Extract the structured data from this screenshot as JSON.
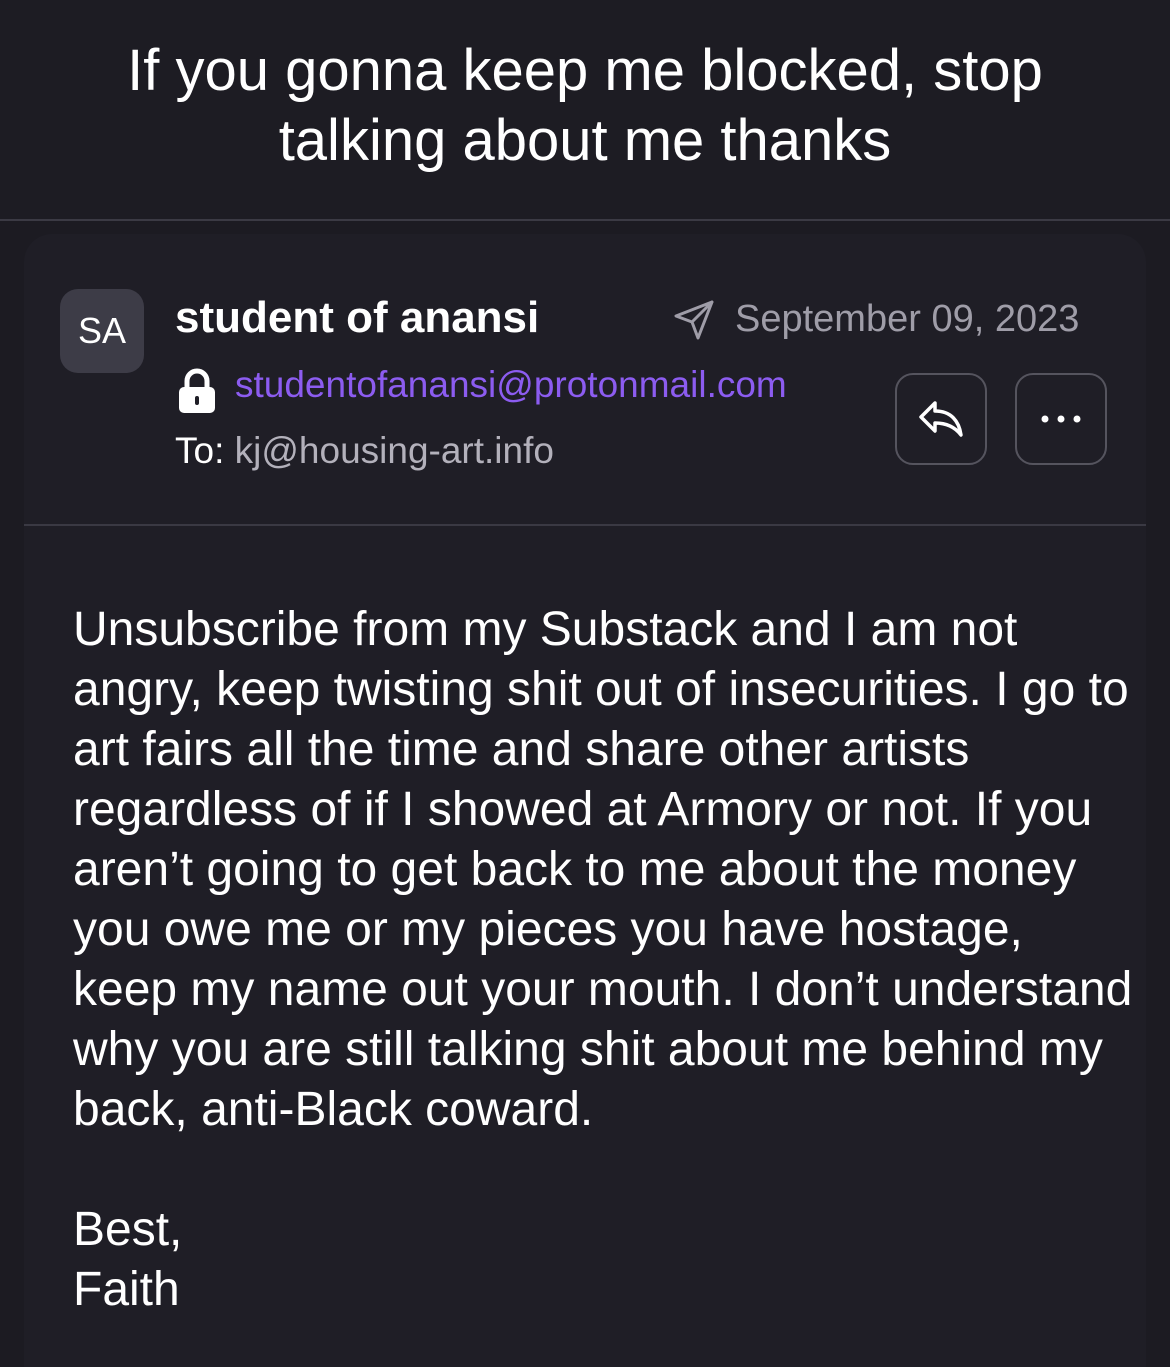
{
  "subject": "If you gonna keep me blocked, stop talking about me thanks",
  "sender": {
    "initials": "SA",
    "name": "student of anansi",
    "email": "studentofanansi@protonmail.com",
    "date": "September 09, 2023"
  },
  "recipient": {
    "label": "To:",
    "address": "kj@housing-art.info"
  },
  "actions": {
    "reply_icon": "reply-icon",
    "more_icon": "more-options-icon",
    "more_glyph": "···"
  },
  "body": {
    "paragraph": "Unsubscribe from my Substack and I am not angry, keep twisting shit out of insecurities. I go to art fairs all the time and share other artists regardless of if I showed at Armory or not. If you aren’t going to get back to me about the money you owe me or my pieces you have hostage, keep my name out your mouth. I don’t understand why you are still talking shit about me behind my back, anti-Black coward.",
    "closing": "Best,",
    "signature": "Faith"
  },
  "colors": {
    "background": "#1c1b22",
    "card": "#1f1e26",
    "email_link": "#8c5cf0",
    "muted_text": "#9f9da8"
  }
}
